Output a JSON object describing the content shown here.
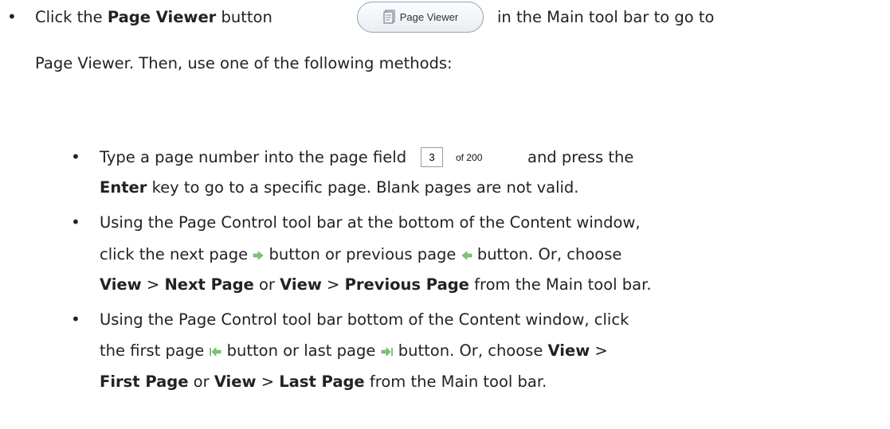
{
  "bullet_char": "•",
  "item1": {
    "line1_pre": "Click the ",
    "line1_bold": "Page Viewer",
    "line1_mid": " button",
    "line1_post": "in the Main tool bar to go to",
    "line2": "Page Viewer. Then, use one of the following methods:"
  },
  "page_viewer_button": {
    "label": "Page Viewer",
    "icon": "page-viewer-icon"
  },
  "page_field": {
    "value": "3",
    "of_label": "of 200"
  },
  "sub1": {
    "line1_pre": "Type a page number into the page field",
    "line1_post": "and press the",
    "line2_bold": "Enter",
    "line2_rest": " key to go to a specific page. Blank pages are not valid."
  },
  "sub2": {
    "line1": "Using the Page Control tool bar at the bottom of the Content window,",
    "line2_a": "click the next page ",
    "line2_b": " button or previous page ",
    "line2_c": " button. Or, choose",
    "line3_view1": "View",
    "line3_sep1": " > ",
    "line3_next": "Next Page",
    "line3_or": " or ",
    "line3_view2": "View",
    "line3_sep2": " > ",
    "line3_prev": "Previous Page",
    "line3_end": " from the Main tool bar."
  },
  "sub3": {
    "line1": "Using the Page Control tool bar bottom of the Content window, click",
    "line2_a": "the first page ",
    "line2_b": " button or last page ",
    "line2_c": " button. Or, choose ",
    "line2_view": "View",
    "line2_sep": " >",
    "line3_first": "First Page",
    "line3_or": " or ",
    "line3_view": "View",
    "line3_sep": " > ",
    "line3_last": "Last Page",
    "line3_end": " from the Main tool bar."
  },
  "colors": {
    "arrow": "#7cc576",
    "text": "#222222",
    "button_border": "#8fa2b8"
  }
}
